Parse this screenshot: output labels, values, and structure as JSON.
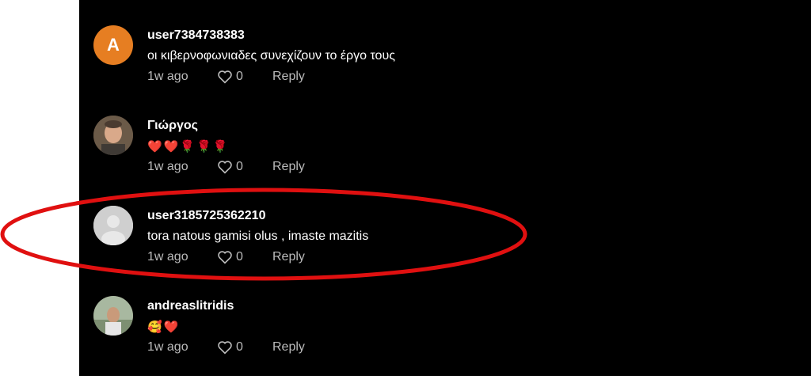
{
  "comments": [
    {
      "avatar_letter": "A",
      "username": "user7384738383",
      "text": "οι κιβερνοφωνιαδες συνεχίζουν το έργο τους",
      "age": "1w ago",
      "likes": "0",
      "reply": "Reply"
    },
    {
      "username": "Γιώργος",
      "text": "❤️❤️🌹🌹🌹",
      "age": "1w ago",
      "likes": "0",
      "reply": "Reply"
    },
    {
      "username": "user3185725362210",
      "text": "tora natous gamisi olus , imaste mazitis",
      "age": "1w ago",
      "likes": "0",
      "reply": "Reply"
    },
    {
      "username": "andreaslitridis",
      "text": "🥰❤️",
      "age": "1w ago",
      "likes": "0",
      "reply": "Reply"
    }
  ],
  "colors": {
    "highlight_ellipse": "#e01010",
    "avatar_letter_bg": "#e67e22"
  }
}
